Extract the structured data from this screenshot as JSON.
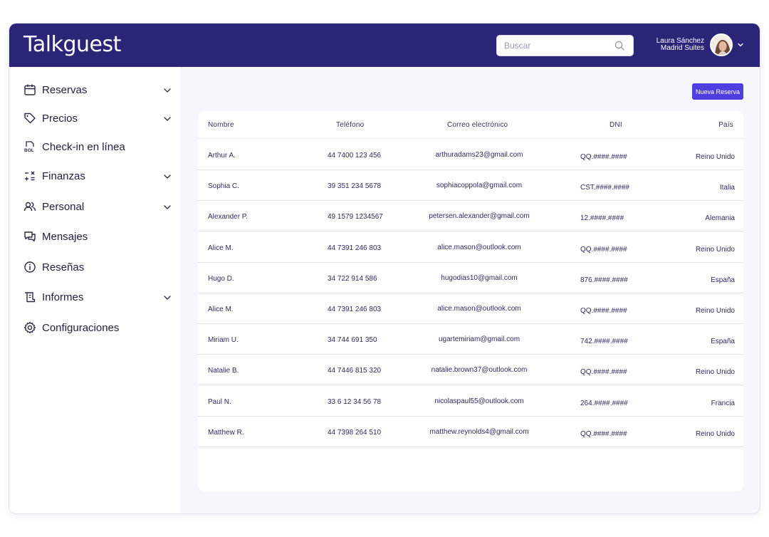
{
  "app": {
    "logo": "Talkguest"
  },
  "search": {
    "placeholder": "Buscar"
  },
  "user": {
    "name": "Laura Sánchez",
    "property": "Madrid Suites"
  },
  "sidebar": {
    "items": [
      {
        "label": "Reservas",
        "icon": "calendar-icon",
        "has_submenu": true
      },
      {
        "label": "Precios",
        "icon": "tag-icon",
        "has_submenu": true
      },
      {
        "label": "Check-in en línea",
        "icon": "checkin-doc-icon",
        "has_submenu": false
      },
      {
        "label": "Finanzas",
        "icon": "calculator-icon",
        "has_submenu": true
      },
      {
        "label": "Personal",
        "icon": "users-icon",
        "has_submenu": true
      },
      {
        "label": "Mensajes",
        "icon": "messages-icon",
        "has_submenu": false
      },
      {
        "label": "Reseñas",
        "icon": "info-icon",
        "has_submenu": false
      },
      {
        "label": "Informes",
        "icon": "report-icon",
        "has_submenu": true
      },
      {
        "label": "Configuraciones",
        "icon": "gear-icon",
        "has_submenu": false
      }
    ]
  },
  "actions": {
    "new_reservation": "Nueva Reserva"
  },
  "table": {
    "headers": {
      "name": "Nombre",
      "phone": "Teléfono",
      "email": "Correo electrónico",
      "dni": "DNI",
      "country": "País"
    },
    "rows": [
      {
        "name": "Arthur A.",
        "phone": "44 7400 123 456",
        "email": "arthuradams23@gmail.com",
        "dni": "QQ.####.####",
        "country": "Reino Unido"
      },
      {
        "name": "Sophia C.",
        "phone": "39 351 234 5678",
        "email": "sophiacoppola@gmail.com",
        "dni": "CST.####.####",
        "country": "Italia"
      },
      {
        "name": "Alexander P.",
        "phone": "49 1579 1234567",
        "email": "petersen.alexander@gmail.com",
        "dni": "12.####.####",
        "country": "Alemania"
      },
      {
        "name": "Alice M.",
        "phone": "44 7391 246 803",
        "email": "alice.mason@outlook.com",
        "dni": "QQ.####.####",
        "country": "Reino Unido"
      },
      {
        "name": "Hugo D.",
        "phone": "34 722 914 586",
        "email": "hugodias10@gmail.com",
        "dni": "876.####.####",
        "country": "España"
      },
      {
        "name": "Alice M.",
        "phone": "44 7391 246 803",
        "email": "alice.mason@outlook.com",
        "dni": "QQ.####.####",
        "country": "Reino Unido"
      },
      {
        "name": "Miriam U.",
        "phone": "34 744 691 350",
        "email": "ugartemiriam@gmail.com",
        "dni": "742.####.####",
        "country": "España"
      },
      {
        "name": "Natalie B.",
        "phone": "44 7446 815 320",
        "email": "natalie.brown37@outlook.com",
        "dni": "QQ.####.####",
        "country": "Reino Unido"
      },
      {
        "name": "Paul N.",
        "phone": "33 6 12 34 56 78",
        "email": "nicolaspaul55@outlook.com",
        "dni": "264.####.####",
        "country": "Francia"
      },
      {
        "name": "Matthew R.",
        "phone": "44 7398 264 510",
        "email": "matthew.reynolds4@gmail.com",
        "dni": "QQ.####.####",
        "country": "Reino Unido"
      }
    ]
  },
  "colors": {
    "header": "#2a2576",
    "accent": "#4f3de0",
    "background": "#f6f6fc"
  }
}
